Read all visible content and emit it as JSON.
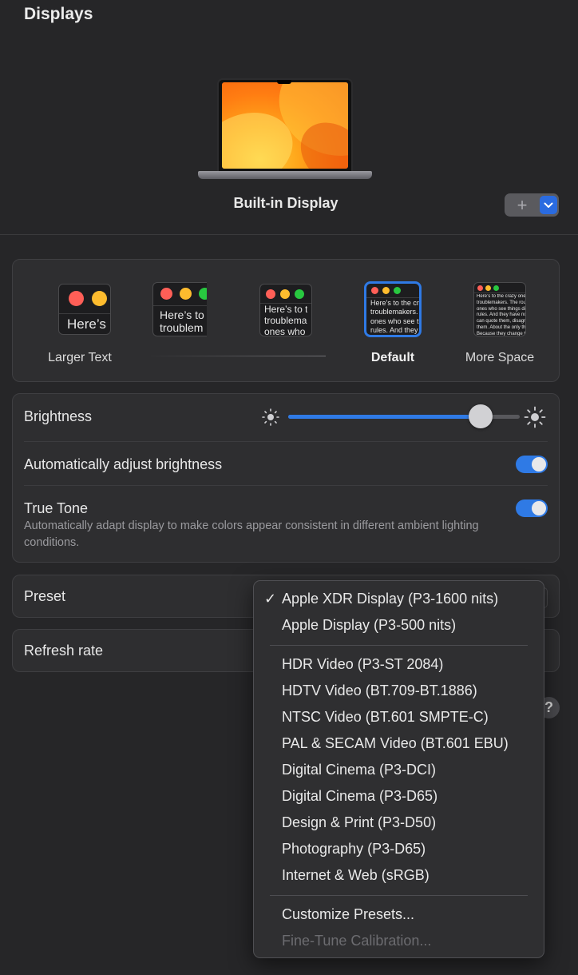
{
  "window": {
    "title": "Displays"
  },
  "display": {
    "name": "Built-in Display",
    "add_label": "+"
  },
  "resolution": {
    "options": [
      {
        "label": "Larger Text",
        "preview": "Here’s"
      },
      {
        "label": "",
        "preview": "Here’s to\ntroublem"
      },
      {
        "label": "",
        "preview": "Here’s to t\ntroublema\nones who"
      },
      {
        "label": "Default",
        "preview": "Here’s to the cr\ntroublemakers.\nones who see t\nrules. And they",
        "selected": true
      },
      {
        "label": "More Space",
        "preview": "Here’s to the crazy one\ntroublemakers. The round\nones who see things di\nrules. And they have no\ncan quote them, disagre\nthem. About the only th\nBecause they change th"
      }
    ]
  },
  "brightness": {
    "label": "Brightness",
    "level": 0.83,
    "auto_label": "Automatically adjust brightness",
    "auto_enabled": true,
    "true_tone_label": "True Tone",
    "true_tone_desc": "Automatically adapt display to make colors appear consistent in different ambient lighting conditions.",
    "true_tone_enabled": true
  },
  "preset": {
    "label": "Preset"
  },
  "refresh": {
    "label": "Refresh rate"
  },
  "help": {
    "label": "?"
  },
  "menu": {
    "check": "✓",
    "group1": [
      "Apple XDR Display (P3-1600 nits)",
      "Apple Display (P3-500 nits)"
    ],
    "group2": [
      "HDR Video (P3-ST 2084)",
      "HDTV Video (BT.709-BT.1886)",
      "NTSC Video (BT.601 SMPTE-C)",
      "PAL & SECAM Video (BT.601 EBU)",
      "Digital Cinema (P3-DCI)",
      "Digital Cinema (P3-D65)",
      "Design & Print (P3-D50)",
      "Photography (P3-D65)",
      "Internet & Web (sRGB)"
    ],
    "customize": "Customize Presets...",
    "fine_tune": "Fine-Tune Calibration..."
  },
  "colors": {
    "accent": "#2f7ae5",
    "traffic_red": "#ff5f57",
    "traffic_yellow": "#febc2e",
    "traffic_green": "#28c840"
  }
}
